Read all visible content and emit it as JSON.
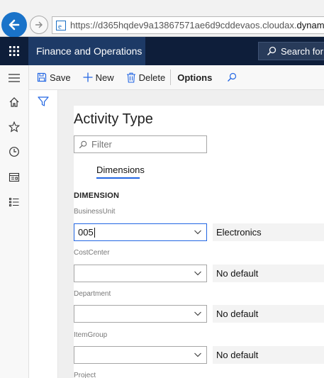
{
  "browser": {
    "url_prefix": "https://d365hqdev9a13867571ae6d9cddevaos.cloudax.",
    "url_domain": "dynamics.com"
  },
  "appbar": {
    "title": "Finance and Operations",
    "search_placeholder": "Search for a"
  },
  "toolbar": {
    "save_label": "Save",
    "new_label": "New",
    "delete_label": "Delete",
    "options_label": "Options"
  },
  "page": {
    "title": "Activity Type",
    "filter_placeholder": "Filter",
    "tab_label": "Dimensions",
    "section_label": "DIMENSION"
  },
  "dimensions": [
    {
      "label": "BusinessUnit",
      "value": "005",
      "default_text": "Electronics"
    },
    {
      "label": "CostCenter",
      "value": "",
      "default_text": "No default"
    },
    {
      "label": "Department",
      "value": "",
      "default_text": "No default"
    },
    {
      "label": "ItemGroup",
      "value": "",
      "default_text": "No default"
    },
    {
      "label": "Project",
      "value": "",
      "default_text": ""
    }
  ],
  "colors": {
    "navbar": "#0e1e3a",
    "title_block": "#1d3a66",
    "accent": "#2266e3",
    "back_button": "#1a73c9"
  }
}
